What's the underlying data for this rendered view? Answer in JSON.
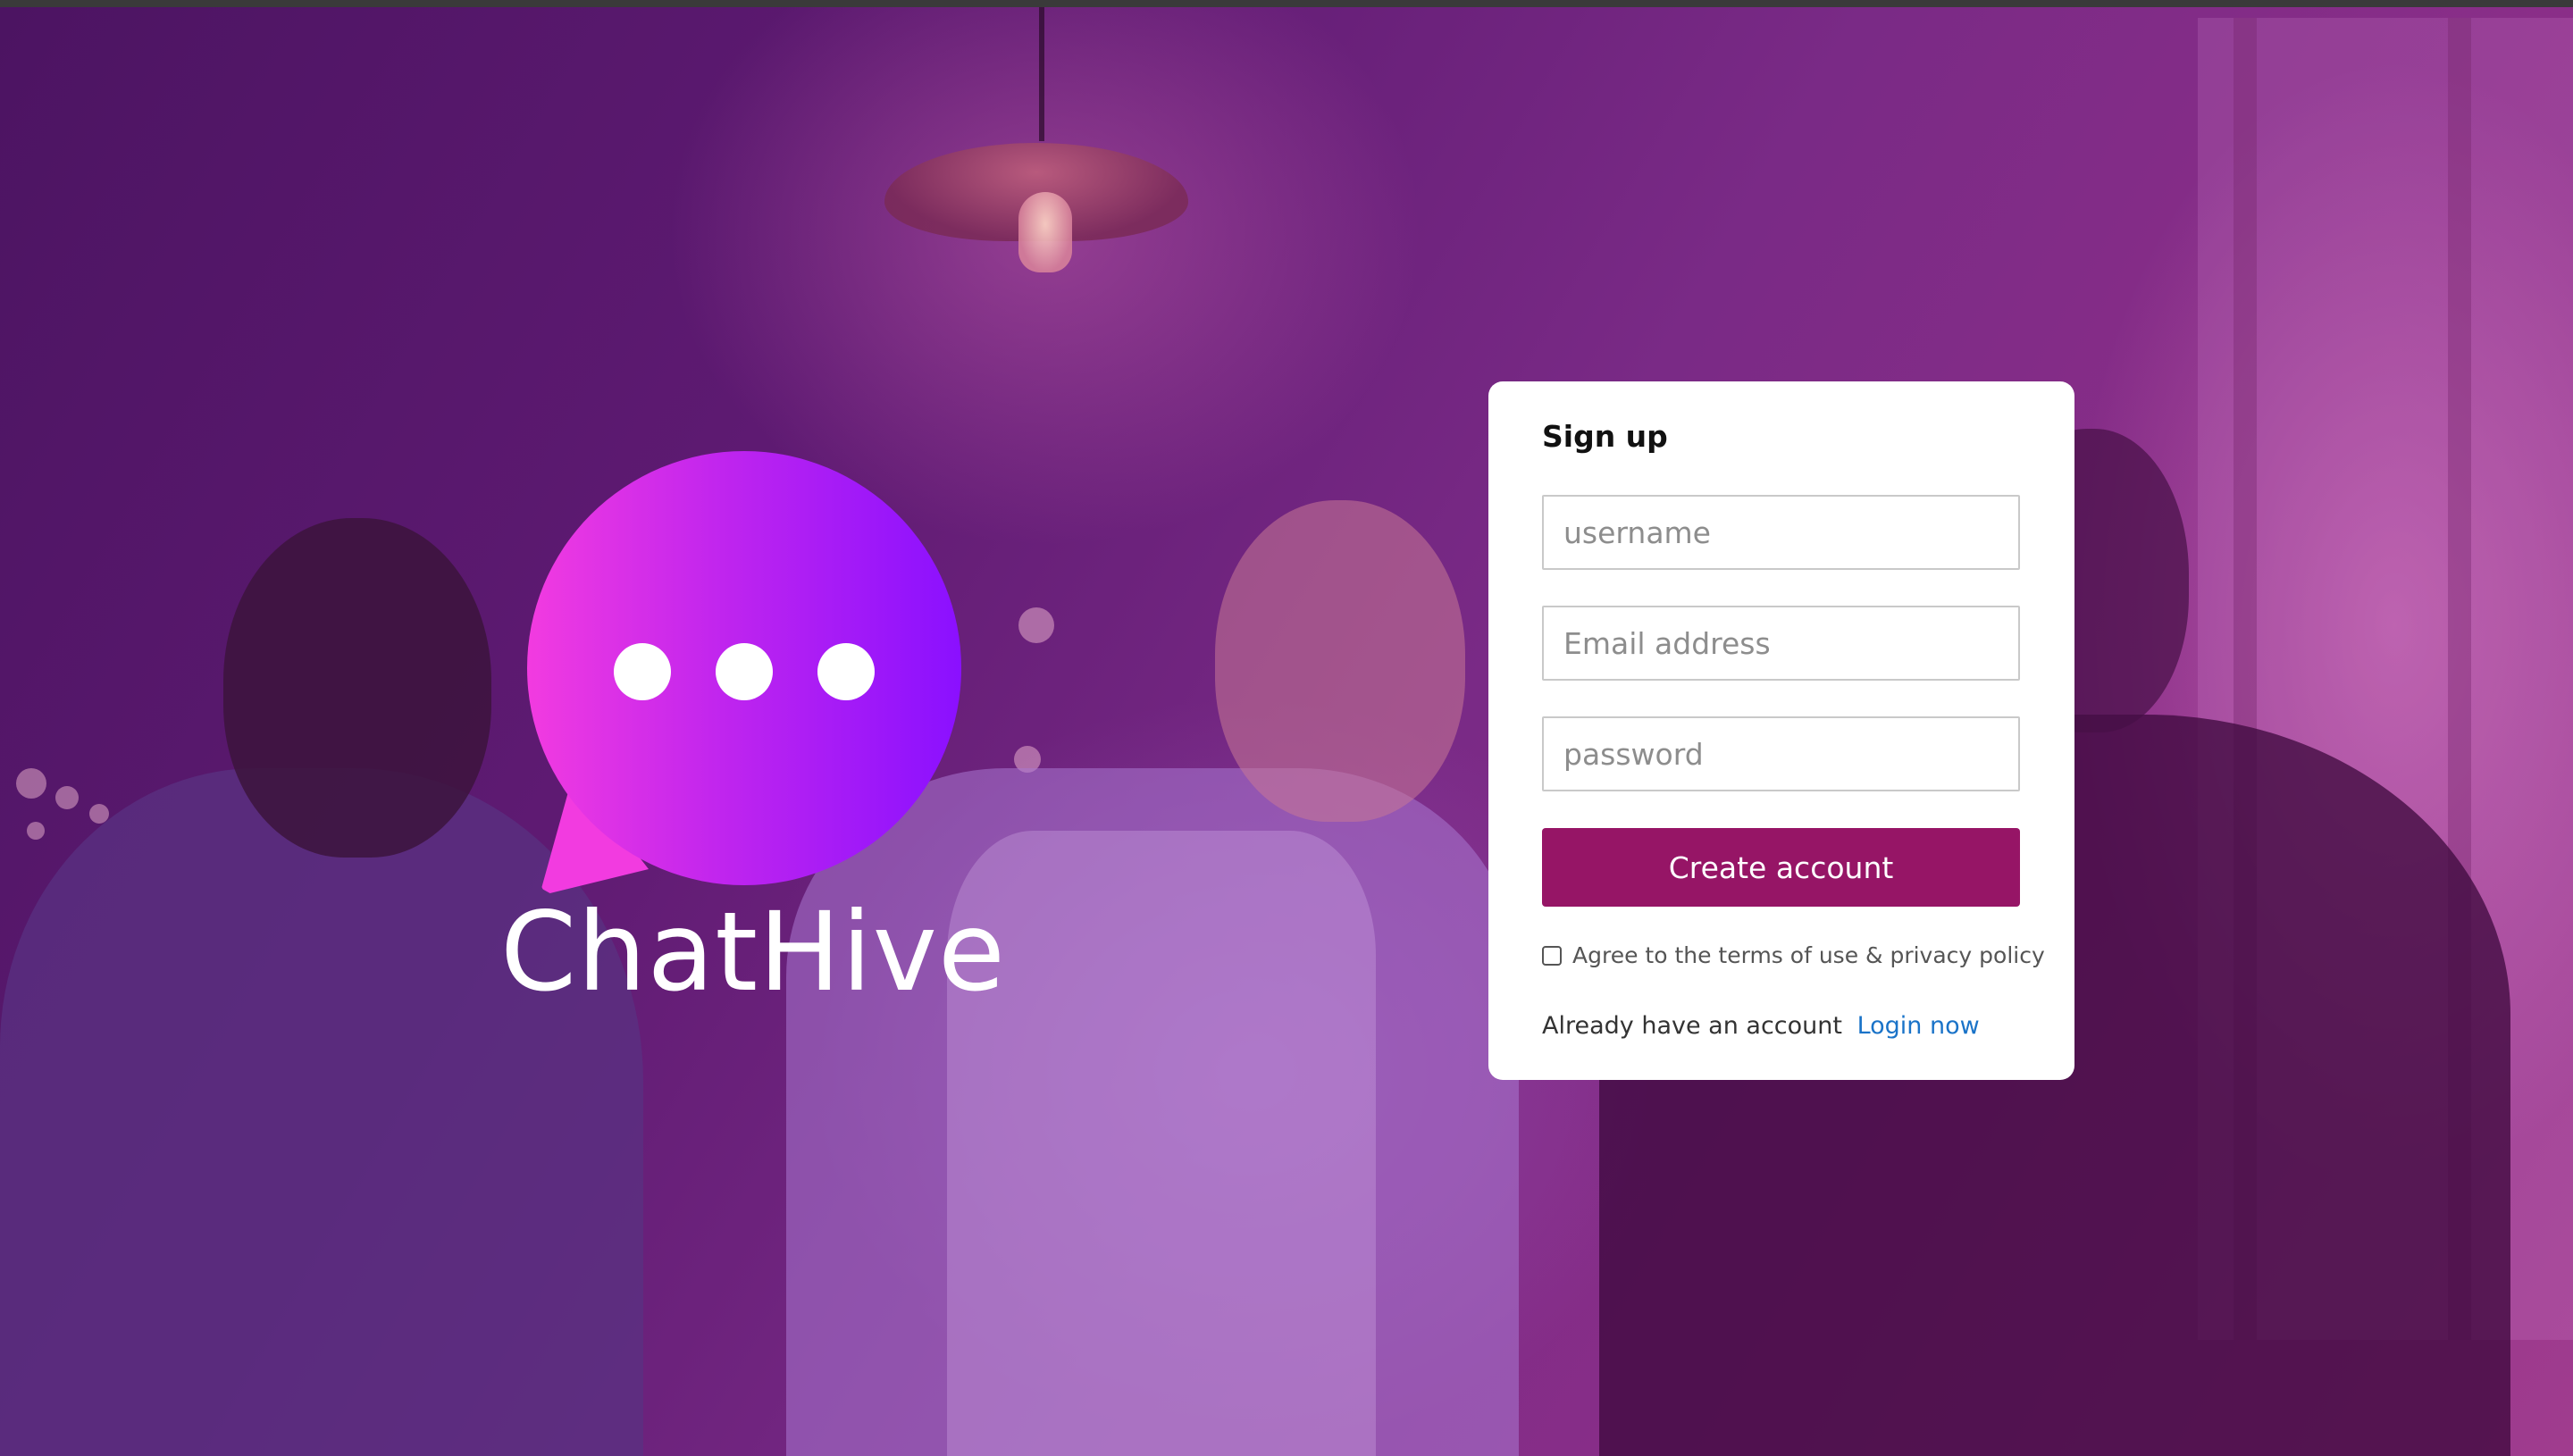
{
  "brand": {
    "name": "ChatHive",
    "logo_icon": "chat-bubble-ellipsis-icon"
  },
  "signup": {
    "title": "Sign up",
    "username_placeholder": "username",
    "email_placeholder": "Email address",
    "password_placeholder": "password",
    "create_button_label": "Create account",
    "terms_label": "Agree to the terms of use & privacy policy",
    "terms_checked": false,
    "login_prompt": "Already have an account",
    "login_link": "Login now"
  },
  "colors": {
    "accent": "#961566",
    "link": "#1a73c8",
    "logo_gradient_start": "#f23be0",
    "logo_gradient_end": "#8a10ff"
  }
}
